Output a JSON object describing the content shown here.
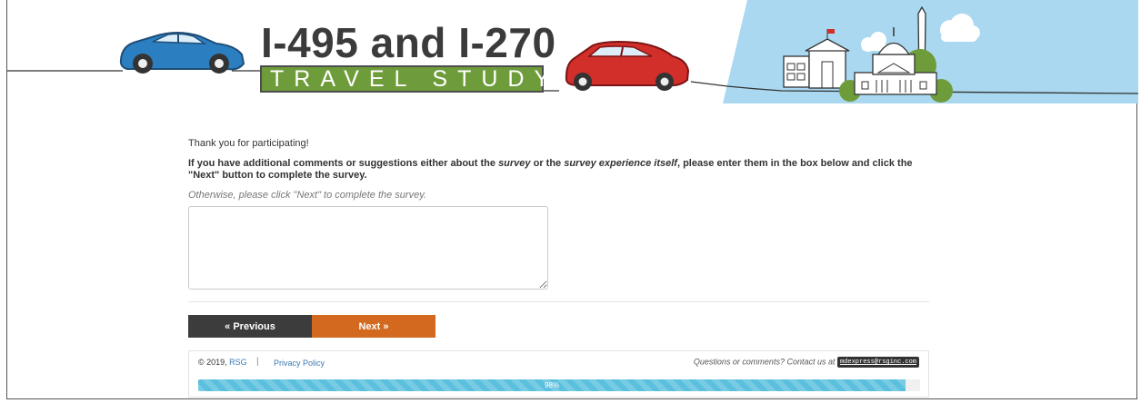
{
  "banner": {
    "title_main": "I-495 and I-270",
    "title_sub": "TRAVEL STUDY"
  },
  "survey": {
    "thanks": "Thank you for participating!",
    "instructions_prefix": "If you have additional comments or suggestions either about the ",
    "instructions_em1": "survey",
    "instructions_mid": " or the ",
    "instructions_em2": "survey experience itself",
    "instructions_suffix": ", please enter them in the box below and click the \"Next\" button to complete the survey.",
    "otherwise": "Otherwise, please click \"Next\" to complete the survey.",
    "comments_value": ""
  },
  "nav": {
    "previous_label": "« Previous",
    "next_label": "Next »"
  },
  "footer": {
    "copyright_prefix": "© 2019, ",
    "rsg_label": "RSG",
    "separator": "|",
    "privacy_label": "Privacy Policy",
    "contact_text": "Questions or comments? Contact us at ",
    "email": "mdexpress@rsginc.com",
    "progress_label": "98%",
    "progress_value": 0.98
  },
  "colors": {
    "accent_green": "#6f9c3b",
    "next_orange": "#d2691e",
    "prev_dark": "#3c3c3c",
    "progress_blue": "#5bc0de",
    "sky_blue": "#a9d8f0",
    "car_blue": "#2b7fc1",
    "car_red": "#d22f2b"
  },
  "icons": [
    "blue-car-icon",
    "red-car-icon",
    "city-skyline-icon",
    "cloud-icon"
  ]
}
